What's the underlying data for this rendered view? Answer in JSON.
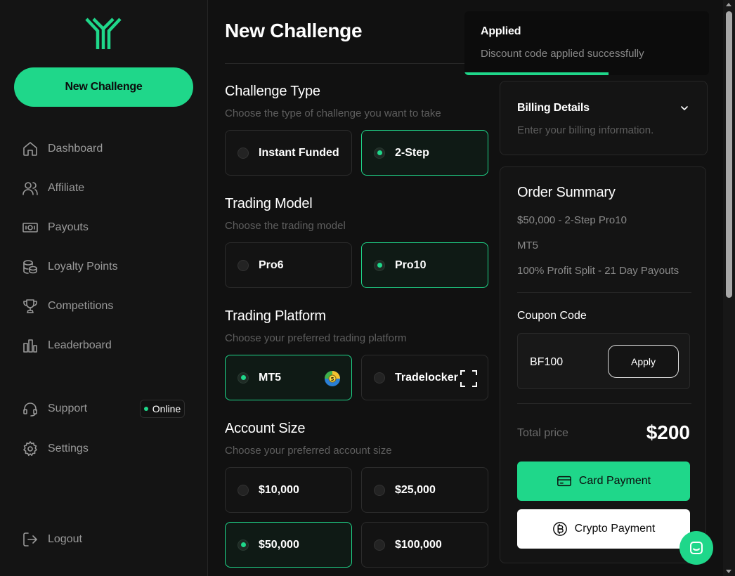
{
  "sidebar": {
    "new_challenge_label": "New Challenge",
    "nav": [
      {
        "label": "Dashboard",
        "icon": "home-icon"
      },
      {
        "label": "Affiliate",
        "icon": "users-icon"
      },
      {
        "label": "Payouts",
        "icon": "banknote-icon"
      },
      {
        "label": "Loyalty Points",
        "icon": "coins-icon"
      },
      {
        "label": "Competitions",
        "icon": "trophy-icon"
      },
      {
        "label": "Leaderboard",
        "icon": "bar-chart-icon"
      }
    ],
    "support_label": "Support",
    "online_label": "Online",
    "settings_label": "Settings",
    "logout_label": "Logout"
  },
  "main": {
    "title": "New Challenge",
    "challenge_type": {
      "title": "Challenge Type",
      "subtitle": "Choose the type of challenge you want to take",
      "options": [
        "Instant Funded",
        "2-Step"
      ],
      "selected": "2-Step"
    },
    "trading_model": {
      "title": "Trading Model",
      "subtitle": "Choose the trading model",
      "options": [
        "Pro6",
        "Pro10"
      ],
      "selected": "Pro10"
    },
    "trading_platform": {
      "title": "Trading Platform",
      "subtitle": "Choose your preferred trading platform",
      "options": [
        "MT5",
        "Tradelocker"
      ],
      "selected": "MT5"
    },
    "account_size": {
      "title": "Account Size",
      "subtitle": "Choose your preferred account size",
      "options": [
        "$10,000",
        "$25,000",
        "$50,000",
        "$100,000"
      ],
      "selected": "$50,000"
    }
  },
  "billing": {
    "title": "Billing Details",
    "subtitle": "Enter your billing information."
  },
  "order": {
    "title": "Order Summary",
    "lines": [
      "$50,000 - 2-Step Pro10",
      "MT5",
      "100% Profit Split - 21 Day Payouts"
    ],
    "coupon_label": "Coupon Code",
    "coupon_value": "BF100",
    "apply_label": "Apply",
    "total_label": "Total price",
    "total_value": "$200",
    "card_payment_label": "Card Payment",
    "crypto_payment_label": "Crypto Payment"
  },
  "toast": {
    "title": "Applied",
    "message": "Discount code applied successfully",
    "progress_fraction": 0.59
  },
  "colors": {
    "accent": "#1fd78a",
    "background": "#111111",
    "card": "#141414"
  }
}
